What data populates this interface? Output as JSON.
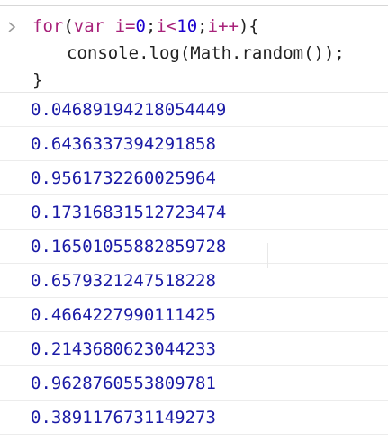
{
  "input": {
    "kw_for": "for",
    "paren_open": "(",
    "kw_var": "var",
    "sp": " ",
    "var_i": "i",
    "eq": "=",
    "zero": "0",
    "semi1": ";",
    "var_i2": "i",
    "lt": "<",
    "ten": "10",
    "semi2": ";",
    "var_i3": "i",
    "inc": "++",
    "close_brace_open": "){",
    "line2": "console.log(Math.random());",
    "line3": "}"
  },
  "outputs": [
    "0.04689194218054449",
    "0.6436337394291858",
    "0.9561732260025964",
    "0.17316831512723474",
    "0.16501055882859728",
    "0.6579321247518228",
    "0.4664227990111425",
    "0.2143680623044233",
    "0.9628760553809781",
    "0.3891176731149273"
  ],
  "colors": {
    "keyword": "#a8227a",
    "number": "#1c00cf",
    "output": "#1a1aa6",
    "text": "#222222"
  }
}
